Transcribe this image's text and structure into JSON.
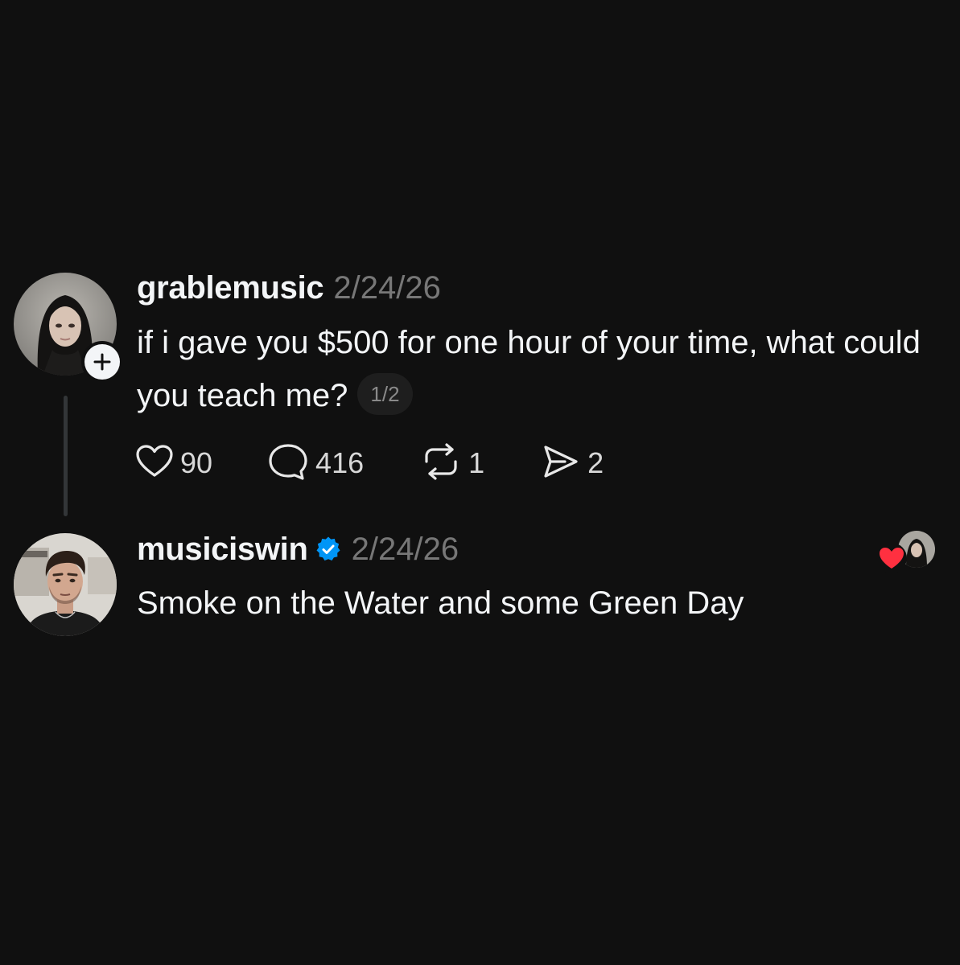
{
  "thread": {
    "post": {
      "username": "grablemusic",
      "timestamp": "2/24/26",
      "text": "if i gave you $500 for one hour of your time, what could you teach  me?",
      "page_indicator": "1/2",
      "avatar_icon": "user-avatar-photo",
      "follow_icon": "plus-icon",
      "actions": {
        "likes": "90",
        "replies": "416",
        "reposts": "1",
        "shares": "2"
      }
    },
    "reply": {
      "username": "musiciswin",
      "verified": true,
      "verified_color": "#0095f6",
      "timestamp": "2/24/26",
      "text": "Smoke on the Water and some Green Day",
      "avatar_icon": "user-avatar-photo",
      "liked_by_author": true,
      "heart_color": "#ff3040"
    }
  },
  "colors": {
    "background": "#101010",
    "primary_text": "#f3f5f7",
    "secondary_text": "#777777"
  }
}
